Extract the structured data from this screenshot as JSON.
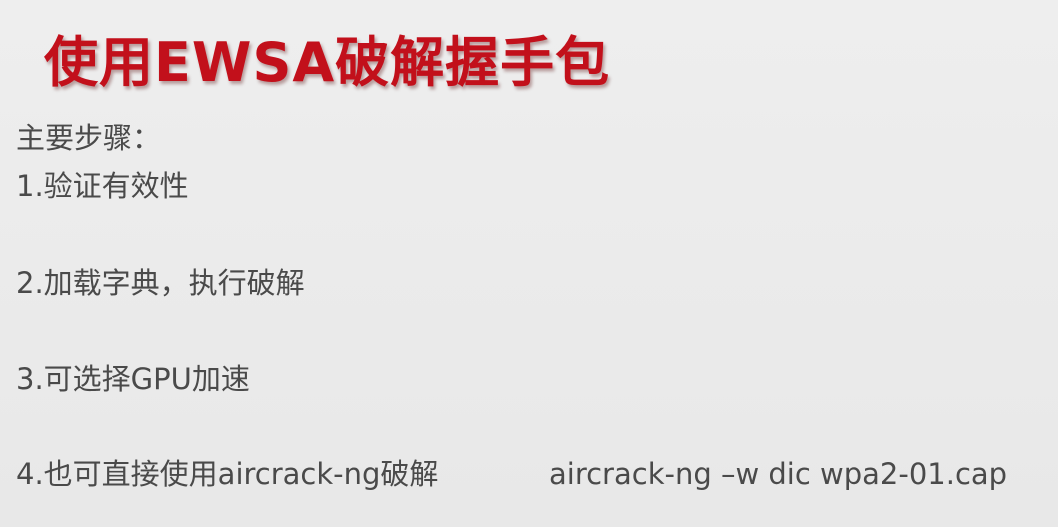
{
  "slide": {
    "title": "使用EWSA破解握手包",
    "intro": "主要步骤：",
    "steps": [
      "1.验证有效性",
      "2.加载字典，执行破解",
      "3.可选择GPU加速",
      "4.也可直接使用aircrack-ng破解"
    ],
    "command": "aircrack-ng –w dic wpa2-01.cap"
  },
  "colors": {
    "title": "#c2101b",
    "body_text": "#4a4a4a",
    "background": "#ebebeb"
  }
}
